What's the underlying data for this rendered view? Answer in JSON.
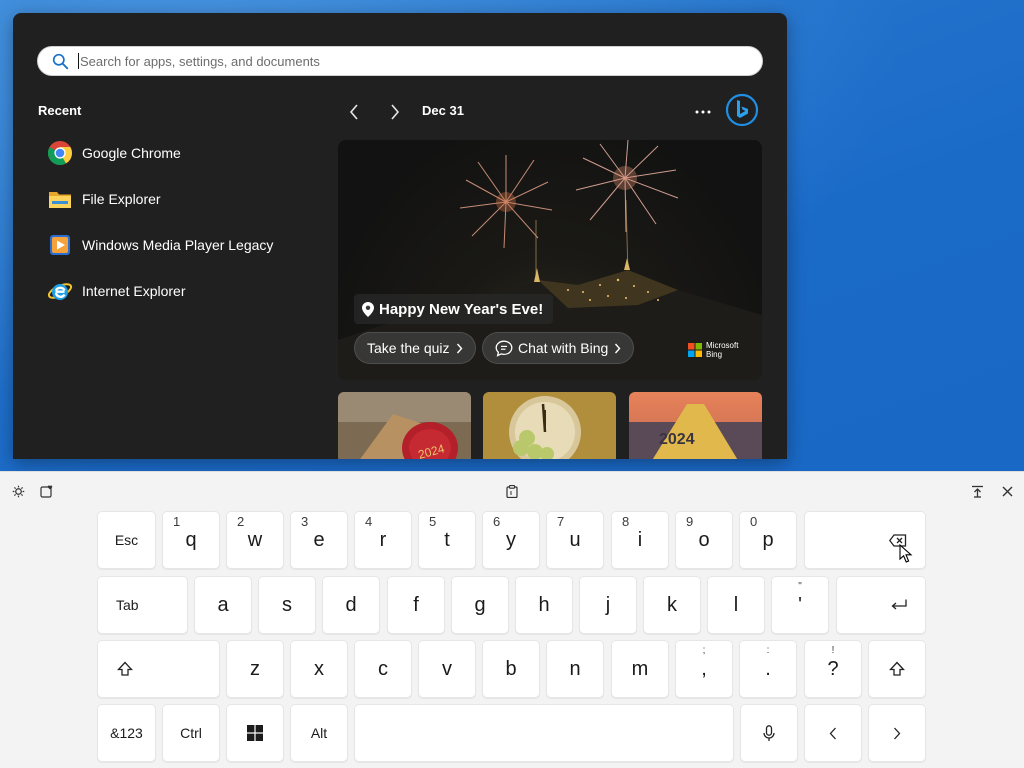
{
  "search": {
    "placeholder": "Search for apps, settings, and documents"
  },
  "recent": {
    "title": "Recent",
    "items": [
      {
        "label": "Google Chrome",
        "icon": "chrome-icon"
      },
      {
        "label": "File Explorer",
        "icon": "file-explorer-icon"
      },
      {
        "label": "Windows Media Player Legacy",
        "icon": "media-player-icon"
      },
      {
        "label": "Internet Explorer",
        "icon": "internet-explorer-icon"
      }
    ]
  },
  "highlights": {
    "date": "Dec 31",
    "hero_title": "Happy New Year's Eve!",
    "quiz_label": "Take the quiz",
    "chat_label": "Chat with Bing",
    "brand_line1": "Microsoft",
    "brand_line2": "Bing",
    "thumbnails": [
      {
        "icon": "champagne-cork-2024-thumbnail"
      },
      {
        "icon": "clock-grapes-thumbnail"
      },
      {
        "icon": "road-2024-thumbnail"
      }
    ]
  },
  "keyboard": {
    "row1": [
      {
        "label": "Esc",
        "type": "fn"
      },
      {
        "label": "q",
        "sub": "1"
      },
      {
        "label": "w",
        "sub": "2"
      },
      {
        "label": "e",
        "sub": "3"
      },
      {
        "label": "r",
        "sub": "4"
      },
      {
        "label": "t",
        "sub": "5"
      },
      {
        "label": "y",
        "sub": "6"
      },
      {
        "label": "u",
        "sub": "7"
      },
      {
        "label": "i",
        "sub": "8"
      },
      {
        "label": "o",
        "sub": "9"
      },
      {
        "label": "p",
        "sub": "0"
      }
    ],
    "row2": [
      {
        "label": "Tab",
        "type": "fn"
      },
      {
        "label": "a"
      },
      {
        "label": "s"
      },
      {
        "label": "d"
      },
      {
        "label": "f"
      },
      {
        "label": "g"
      },
      {
        "label": "h"
      },
      {
        "label": "j"
      },
      {
        "label": "k"
      },
      {
        "label": "l"
      },
      {
        "label": "'",
        "sub": "\""
      }
    ],
    "row3": [
      {
        "label": "z"
      },
      {
        "label": "x"
      },
      {
        "label": "c"
      },
      {
        "label": "v"
      },
      {
        "label": "b"
      },
      {
        "label": "n"
      },
      {
        "label": "m"
      },
      {
        "label": ",",
        "sub": ";"
      },
      {
        "label": ".",
        "sub": ":"
      },
      {
        "label": "?",
        "sub": "!"
      }
    ],
    "row4": {
      "symbols": "&123",
      "ctrl": "Ctrl",
      "alt": "Alt"
    }
  },
  "colors": {
    "panel_bg": "#202020",
    "desktop_blue": "#1a6ac8",
    "keyboard_bg": "#f3f3f3",
    "bing_blue": "#1f8fe5"
  }
}
